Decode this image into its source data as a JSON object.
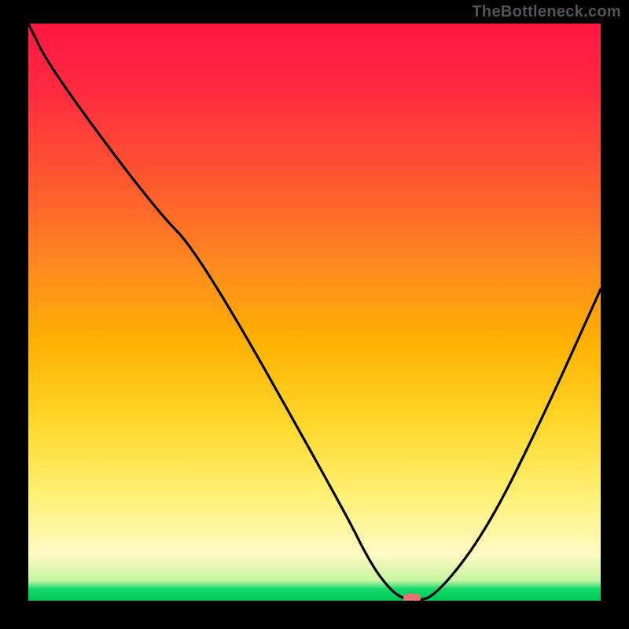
{
  "watermark": "TheBottleneck.com",
  "colors": {
    "page_bg": "#000000",
    "grad_top": "#ff1744",
    "grad_mid": "#ffd92e",
    "grad_bottom": "#00c853",
    "curve": "#000000",
    "marker": "#e57373"
  },
  "chart_data": {
    "type": "line",
    "title": "",
    "xlabel": "",
    "ylabel": "",
    "xlim": [
      0,
      100
    ],
    "ylim": [
      0,
      100
    ],
    "legend": false,
    "grid": false,
    "series": [
      {
        "name": "bottleneck-curve",
        "x": [
          0,
          4,
          22,
          30,
          55,
          60,
          64,
          67,
          71,
          80,
          90,
          100
        ],
        "values": [
          100,
          92,
          68,
          60,
          16,
          6,
          1,
          0,
          0.5,
          12,
          32,
          54
        ]
      }
    ],
    "annotations": [
      {
        "name": "optimal-marker",
        "x": 67,
        "y": 0.4
      }
    ]
  }
}
